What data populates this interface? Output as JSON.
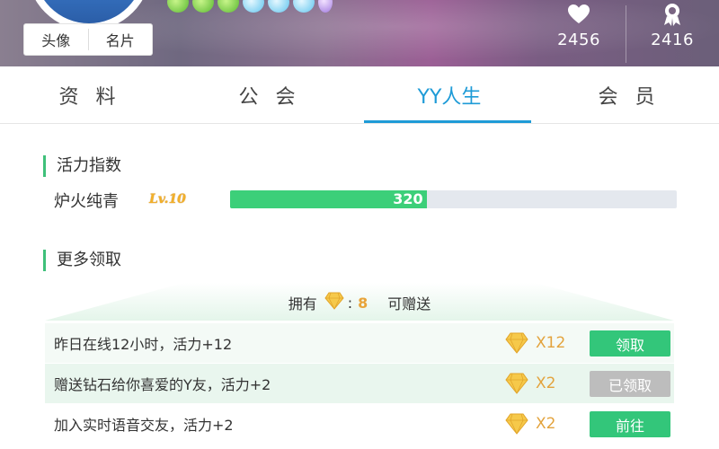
{
  "profile": {
    "avatar_tabs": [
      "头像",
      "名片"
    ],
    "stats": {
      "likes": "2456",
      "badges": "2416"
    }
  },
  "tabs": [
    "资 料",
    "公 会",
    "YY人生",
    "会 员"
  ],
  "active_tab": "YY人生",
  "vitality": {
    "section_title": "活力指数",
    "level_name": "炉火纯青",
    "level_badge": "Lv.10",
    "progress_value": "320",
    "progress_fraction": 0.44
  },
  "more": {
    "section_title": "更多领取",
    "owned_label": "拥有",
    "owned_colon": ":",
    "owned_count": "8",
    "owned_suffix": "可赠送"
  },
  "tasks": [
    {
      "text": "昨日在线12小时，活力+12",
      "multiplier": "X12",
      "button": "领取",
      "state": "active"
    },
    {
      "text": "赠送钻石给你喜爱的Y友，活力+2",
      "multiplier": "X2",
      "button": "已领取",
      "state": "done"
    },
    {
      "text": "加入实时语音交友，活力+2",
      "multiplier": "X2",
      "button": "前往",
      "state": "active"
    }
  ],
  "colors": {
    "accent": "#1e9bd7",
    "progress": "#3ccf79",
    "button_green": "#33c67a",
    "button_gray": "#bdbdbd",
    "multiplier": "#e3a33d"
  },
  "icons": {
    "likes": "heart-icon",
    "badges": "ribbon-badge-icon",
    "diamond": "diamond-icon"
  }
}
